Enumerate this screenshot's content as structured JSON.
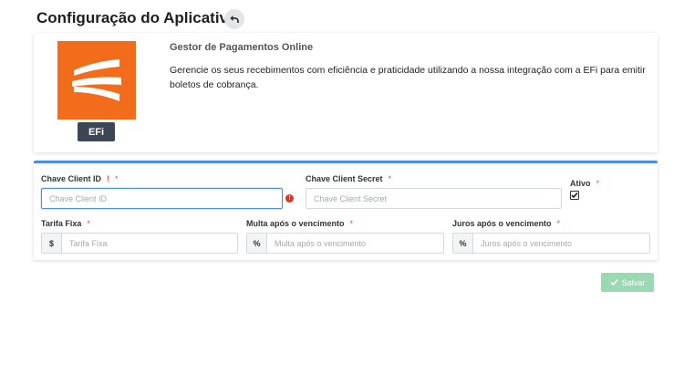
{
  "header": {
    "title": "Configuração do Aplicativo"
  },
  "app": {
    "name": "Gestor de Pagamentos Online",
    "description": "Gerencie os seus recebimentos com eficiência e praticidade utilizando a nossa integração com a EFi para emitir boletos de cobrança.",
    "logo_label": "EFi",
    "brand_color": "#f26c1c"
  },
  "form": {
    "client_id": {
      "label": "Chave Client ID",
      "error_mark": "!",
      "required": "*",
      "placeholder": "Chave Client ID",
      "value": ""
    },
    "client_secret": {
      "label": "Chave Client Secret",
      "required": "*",
      "placeholder": "Chave Client Secret",
      "value": ""
    },
    "active": {
      "label": "Ativo",
      "required": "*",
      "checked": true
    },
    "fixed_fee": {
      "label": "Tarifa Fixa",
      "required": "*",
      "addon": "$",
      "placeholder": "Tarifa Fixa"
    },
    "late_fine": {
      "label": "Multa após o vencimento",
      "required": "*",
      "addon": "%",
      "placeholder": "Multa após o vencimento"
    },
    "late_interest": {
      "label": "Juros após o vencimento",
      "required": "*",
      "addon": "%",
      "placeholder": "Juros após o vencimento"
    }
  },
  "actions": {
    "save_label": "Salvar"
  },
  "colors": {
    "accent": "#4a90e2",
    "error": "#d9362a",
    "save_disabled": "#9ad9b2"
  }
}
